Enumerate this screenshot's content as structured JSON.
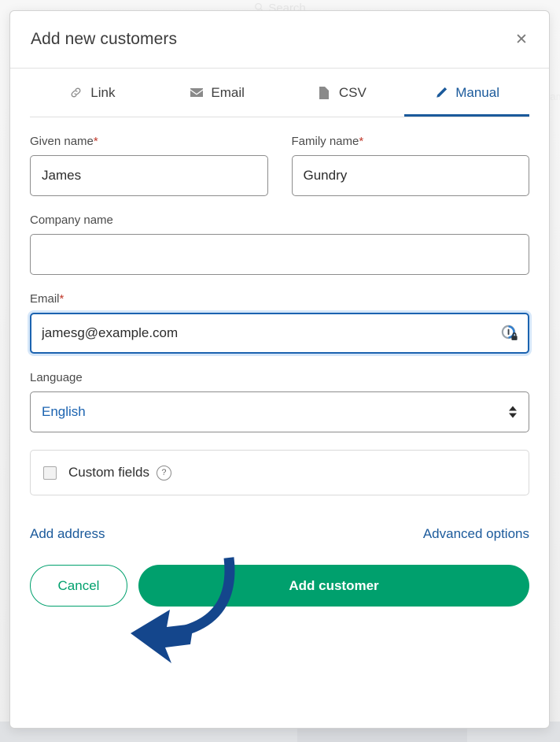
{
  "background": {
    "search_placeholder": "Search",
    "search_icon": "magnifier-icon",
    "right_column_text": "Name"
  },
  "modal": {
    "title": "Add new customers",
    "close_icon": "close-icon",
    "close_label": "✕",
    "tabs": [
      {
        "label": "Link",
        "icon": "link-icon",
        "active": false
      },
      {
        "label": "Email",
        "icon": "envelope-icon",
        "active": false
      },
      {
        "label": "CSV",
        "icon": "file-icon",
        "active": false
      },
      {
        "label": "Manual",
        "icon": "pencil-icon",
        "active": true
      }
    ],
    "fields": {
      "given_name": {
        "label": "Given name",
        "required": true,
        "required_marker": "*",
        "value": "James",
        "placeholder": ""
      },
      "family_name": {
        "label": "Family name",
        "required": true,
        "required_marker": "*",
        "value": "Gundry",
        "placeholder": ""
      },
      "company_name": {
        "label": "Company name",
        "required": false,
        "value": "",
        "placeholder": ""
      },
      "email": {
        "label": "Email",
        "required": true,
        "required_marker": "*",
        "value": "jamesg@example.com",
        "placeholder": "",
        "focused": true,
        "adornment_icon": "password-manager-lock-icon"
      },
      "language": {
        "label": "Language",
        "required": false,
        "selected": "English",
        "arrows_icon": "chevron-up-down-icon"
      }
    },
    "custom_fields": {
      "checkbox_name": "custom-fields-checkbox",
      "checked": false,
      "label": "Custom fields",
      "help_icon": "question-mark-icon",
      "help_glyph": "?"
    },
    "links": {
      "add_address": "Add address",
      "advanced_options": "Advanced options"
    },
    "footer": {
      "cancel_label": "Cancel",
      "submit_label": "Add customer"
    }
  },
  "annotation": {
    "arrow_icon": "curved-arrow-pointing-left",
    "color": "#14468c"
  },
  "colors": {
    "brand_green": "#00a06d",
    "link_blue": "#1b5a9b",
    "select_blue": "#1b63b0",
    "required_red": "#c0392b",
    "focus_border": "#1b63b0",
    "annotation_blue": "#14468c"
  }
}
